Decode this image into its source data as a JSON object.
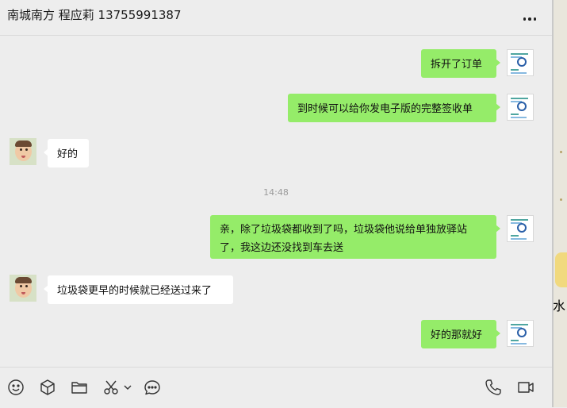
{
  "header": {
    "title": "南城南方 程应莉 13755991387",
    "more_icon": "more-dots-icon"
  },
  "messages": [
    {
      "from": "self",
      "text": "拆开了订单"
    },
    {
      "from": "self",
      "text": "到时候可以给你发电子版的完整签收单"
    },
    {
      "from": "other",
      "text": "好的"
    },
    {
      "from": "self",
      "text": "亲，除了垃圾袋都收到了吗，垃圾袋他说给单独放驿站了，我这边还没找到车去送"
    },
    {
      "from": "other",
      "text": "垃圾袋更早的时候就已经送过来了"
    },
    {
      "from": "self",
      "text": "好的那就好"
    }
  ],
  "timestamp": "14:48",
  "toolbar": {
    "left_icons": [
      "emoji-icon",
      "package-icon",
      "folder-icon",
      "scissors-icon",
      "chevron-down-icon",
      "chat-bubble-icon"
    ],
    "right_icons": [
      "phone-icon",
      "video-icon"
    ]
  },
  "desktop": {
    "partial_label": "水电"
  },
  "colors": {
    "self_bubble": "#95ec69",
    "other_bubble": "#ffffff",
    "background": "#ededed"
  }
}
